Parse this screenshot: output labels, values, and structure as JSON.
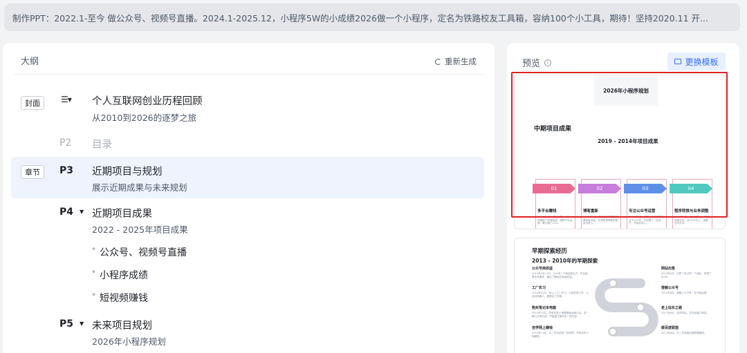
{
  "prompt": {
    "text": "制作PPT：2022.1-至今 做公众号、视频号直播。2024.1-2025.12，小程序5W的小成绩2026做一个小程序，定名为铁路校友工具箱，容纳100个小工具，期待！坚持2020.11 开..."
  },
  "outline": {
    "title": "大纲",
    "regenerate_label": "重新生成",
    "rows": [
      {
        "tag": "封面",
        "title": "个人互联网创业历程回顾",
        "subtitle": "从2010到2026的逐梦之旅"
      },
      {
        "page": "P2",
        "title": "目录"
      },
      {
        "tag": "章节",
        "page": "P3",
        "title": "近期项目与规划",
        "subtitle": "展示近期成果与未来规划"
      },
      {
        "page": "P4",
        "title": "近期项目成果",
        "subtitle": "2022 - 2025年项目成果",
        "bullets": [
          "公众号、视频号直播",
          "小程序成绩",
          "短视频赚钱"
        ]
      },
      {
        "page": "P5",
        "title": "未来项目规划",
        "subtitle": "2026年小程序规划"
      }
    ]
  },
  "preview": {
    "label": "预览",
    "swap_template_label": "更换模板",
    "slide1": {
      "cover_title": "2026年小程序规划",
      "heading": "中期项目成果",
      "subheading": "2019 - 2014年项目成果",
      "cards": [
        {
          "num": "01",
          "title": "多平台赚钱",
          "color": "#e86b94",
          "text": "2019年6月，借上分享。4月，短剧推广获得成绩，借助平台运营，累计赚了10%。"
        },
        {
          "num": "02",
          "title": "博客重新",
          "color": "#c77ddb",
          "text": "2019年6月，同时在博客重新积累读者流量，在博客更博客积累读书收入。"
        },
        {
          "num": "03",
          "title": "专注公众号运营",
          "color": "#5d8fe6",
          "text": "2019年7月，借助公众号发表专注于公众号，并积累了一些用户，开始有收入。"
        },
        {
          "num": "04",
          "title": "程序转换与业务调整",
          "color": "#4fc9c0",
          "text": "2019年8月，在小程序上，持续转换业务，在2014年上，调整业务方向。"
        }
      ]
    },
    "slide2": {
      "heading": "早期探索经历",
      "subheading": "2013 - 2010年的早期探索",
      "left_items": [
        {
          "title": "公众号商收益",
          "text": "2010年5月12日，公众号一个商品类云方，先后面等先收集收，最后了解这些商品收益。"
        },
        {
          "title": "工厂实习",
          "text": "2010年12月，在以上工厂实习，以前自然工作，以及对机器人，都是自工作等。"
        },
        {
          "title": "购买笔记本电脑",
          "text": "2010年10月，同驻在线上管理基础运营以后，这一篇几天的内容，开始建立整体的一些内容。"
        },
        {
          "title": "自学网上赚钱",
          "text": "2010年11月，大二在自创领一些收获，开始自学上网赚钱。"
        }
      ],
      "right_items": [
        {
          "title": "网站出售",
          "text": "2012年5月，出售了自己的一个网站，获得了8000。"
        },
        {
          "title": "接触公众号",
          "text": "2012年8月，接触了公众号，并开始运营。"
        },
        {
          "title": "走上站长之路",
          "text": "2011年9月，自学网站，并开始建立网站。"
        },
        {
          "title": "做百度联盟",
          "text": "2011年8月，大二开始做百度联盟赚钱。"
        }
      ]
    }
  }
}
